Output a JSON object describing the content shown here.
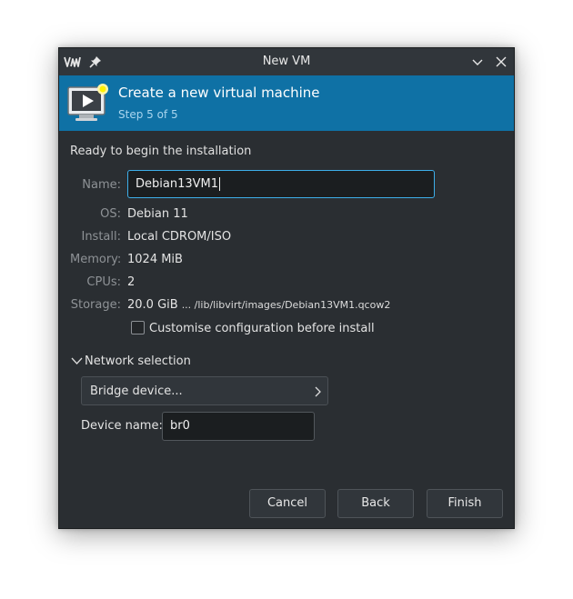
{
  "window": {
    "title": "New VM"
  },
  "banner": {
    "title": "Create a new virtual machine",
    "step": "Step 5 of 5"
  },
  "summary": {
    "ready_text": "Ready to begin the installation",
    "name_label": "Name:",
    "name_value": "Debian13VM1",
    "os_label": "OS:",
    "os_value": "Debian 11",
    "install_label": "Install:",
    "install_value": "Local CDROM/ISO",
    "memory_label": "Memory:",
    "memory_value": "1024 MiB",
    "cpus_label": "CPUs:",
    "cpus_value": "2",
    "storage_label": "Storage:",
    "storage_size": "20.0 GiB",
    "storage_path": "... /lib/libvirt/images/Debian13VM1.qcow2"
  },
  "customise": {
    "label": "Customise configuration before install",
    "checked": false
  },
  "network": {
    "section_label": "Network selection",
    "selection": "Bridge device...",
    "device_name_label": "Device name:",
    "device_name_value": "br0"
  },
  "buttons": {
    "cancel": "Cancel",
    "back": "Back",
    "finish": "Finish"
  },
  "colors": {
    "banner_bg": "#0f71a5",
    "window_bg": "#2a2e32",
    "focus_border": "#3daee9"
  }
}
